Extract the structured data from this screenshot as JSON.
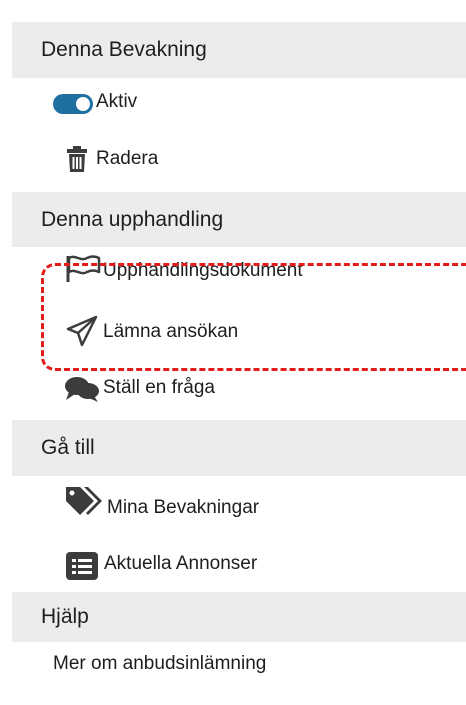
{
  "sections": {
    "bevakning": {
      "title": "Denna Bevakning",
      "items": [
        {
          "label": "Aktiv",
          "icon": "toggle-icon"
        },
        {
          "label": "Radera",
          "icon": "trash-icon"
        }
      ]
    },
    "upphandling": {
      "title": "Denna upphandling",
      "items": [
        {
          "label": "Upphandlingsdokument",
          "icon": "flag-icon"
        },
        {
          "label": "Lämna ansökan",
          "icon": "paper-plane-icon"
        },
        {
          "label": "Ställ en fråga",
          "icon": "chat-bubbles-icon"
        }
      ]
    },
    "ga_till": {
      "title": "Gå till",
      "items": [
        {
          "label": "Mina Bevakningar",
          "icon": "tags-icon"
        },
        {
          "label": "Aktuella Annonser",
          "icon": "list-icon"
        }
      ]
    },
    "hjalp": {
      "title": "Hjälp",
      "items": [
        {
          "label": "Mer om anbudsinlämning"
        }
      ]
    }
  },
  "colors": {
    "header_bg": "#ececec",
    "accent": "#1f6fa0",
    "icon_dark": "#3c3c3c",
    "highlight_dash": "#e21b1b"
  }
}
